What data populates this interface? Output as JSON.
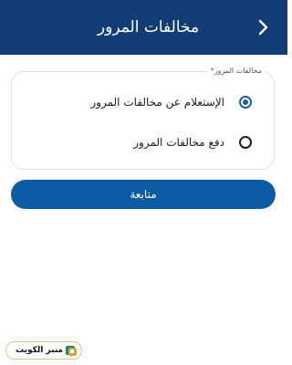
{
  "header": {
    "title": "مخالفات المرور",
    "back_icon": "chevron-right-icon"
  },
  "colors": {
    "header_bg": "#123d74",
    "button_bg": "#0d5aa5",
    "radio_selected": "#1f5fa6"
  },
  "form": {
    "legend": "مخالفات المرور*",
    "options": [
      {
        "label": "الإستعلام عن مخالفات المرور",
        "selected": true
      },
      {
        "label": "دفع مخالفات المرور",
        "selected": false
      }
    ]
  },
  "actions": {
    "continue_label": "متابعة"
  },
  "watermark": {
    "text": "منبر الكويت"
  }
}
